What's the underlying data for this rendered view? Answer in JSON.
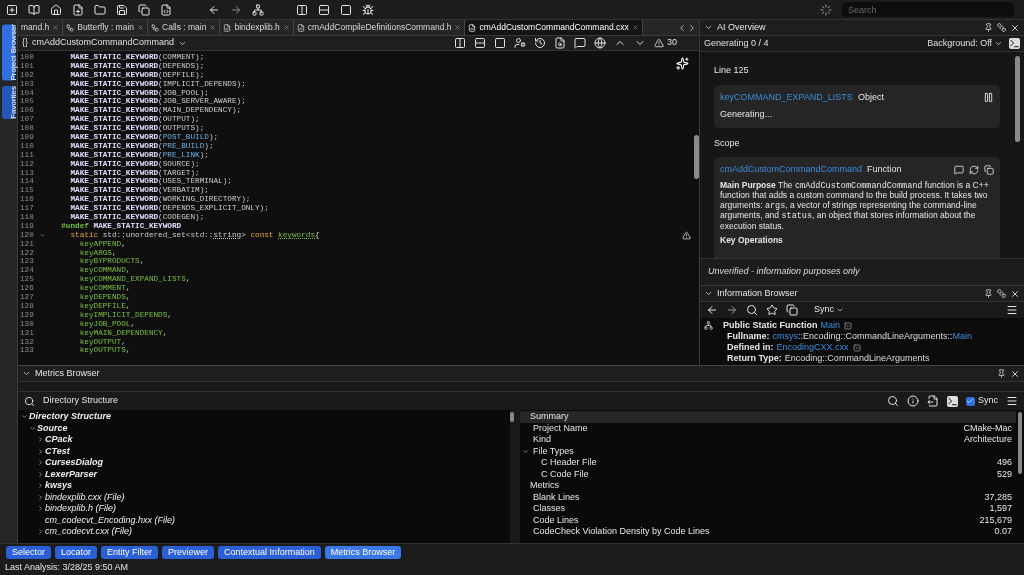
{
  "toolbar": {
    "search": {
      "placeholder": "Search"
    }
  },
  "side_tabs": [
    {
      "label": "Project Browser",
      "selected": true
    },
    {
      "label": "Favorites",
      "selected": false
    }
  ],
  "editor": {
    "tabs": [
      {
        "label": "mand.h",
        "kind": "plain",
        "selected": false
      },
      {
        "label": "Butterfly : main",
        "kind": "graph",
        "selected": false
      },
      {
        "label": "Calls : main",
        "kind": "graph",
        "selected": false
      },
      {
        "label": "bindexplib.h",
        "kind": "file",
        "selected": false
      },
      {
        "label": "cmAddCompileDefinitionsCommand.h",
        "kind": "file",
        "selected": false
      },
      {
        "label": "cmAddCustomCommandCommand.cxx",
        "kind": "file",
        "selected": true
      }
    ],
    "breadcrumb": {
      "symbol": "{}",
      "label": "cmAddCustomCommandCommand"
    },
    "warning_count": "30",
    "lines": [
      {
        "number": "100",
        "segments": [
          {
            "text": "    MAKE_STATIC_KEYWORD",
            "kind": "macro"
          },
          {
            "text": "(COMMENT);",
            "kind": "plain"
          }
        ]
      },
      {
        "number": "101",
        "segments": [
          {
            "text": "    MAKE_STATIC_KEYWORD",
            "kind": "macro"
          },
          {
            "text": "(DEPENDS);",
            "kind": "plain"
          }
        ]
      },
      {
        "number": "102",
        "segments": [
          {
            "text": "    MAKE_STATIC_KEYWORD",
            "kind": "macro"
          },
          {
            "text": "(DEPFILE);",
            "kind": "plain"
          }
        ]
      },
      {
        "number": "103",
        "segments": [
          {
            "text": "    MAKE_STATIC_KEYWORD",
            "kind": "macro"
          },
          {
            "text": "(IMPLICIT_DEPENDS);",
            "kind": "plain"
          }
        ]
      },
      {
        "number": "104",
        "segments": [
          {
            "text": "    MAKE_STATIC_KEYWORD",
            "kind": "macro"
          },
          {
            "text": "(JOB_POOL);",
            "kind": "plain"
          }
        ]
      },
      {
        "number": "105",
        "segments": [
          {
            "text": "    MAKE_STATIC_KEYWORD",
            "kind": "macro"
          },
          {
            "text": "(JOB_SERVER_AWARE);",
            "kind": "plain"
          }
        ]
      },
      {
        "number": "106",
        "segments": [
          {
            "text": "    MAKE_STATIC_KEYWORD",
            "kind": "macro"
          },
          {
            "text": "(MAIN_DEPENDENCY);",
            "kind": "plain"
          }
        ]
      },
      {
        "number": "107",
        "segments": [
          {
            "text": "    MAKE_STATIC_KEYWORD",
            "kind": "macro"
          },
          {
            "text": "(OUTPUT);",
            "kind": "plain"
          }
        ]
      },
      {
        "number": "108",
        "segments": [
          {
            "text": "    MAKE_STATIC_KEYWORD",
            "kind": "macro"
          },
          {
            "text": "(OUTPUTS);",
            "kind": "plain"
          }
        ]
      },
      {
        "number": "109",
        "segments": [
          {
            "text": "    MAKE_STATIC_KEYWORD",
            "kind": "macro"
          },
          {
            "text": "(",
            "kind": "plain"
          },
          {
            "text": "POST_BUILD",
            "kind": "constant"
          },
          {
            "text": ");",
            "kind": "plain"
          }
        ]
      },
      {
        "number": "110",
        "segments": [
          {
            "text": "    MAKE_STATIC_KEYWORD",
            "kind": "macro"
          },
          {
            "text": "(",
            "kind": "plain"
          },
          {
            "text": "PRE_BUILD",
            "kind": "constant"
          },
          {
            "text": ");",
            "kind": "plain"
          }
        ]
      },
      {
        "number": "111",
        "segments": [
          {
            "text": "    MAKE_STATIC_KEYWORD",
            "kind": "macro"
          },
          {
            "text": "(",
            "kind": "plain"
          },
          {
            "text": "PRE_LINK",
            "kind": "constant"
          },
          {
            "text": ");",
            "kind": "plain"
          }
        ]
      },
      {
        "number": "112",
        "segments": [
          {
            "text": "    MAKE_STATIC_KEYWORD",
            "kind": "macro"
          },
          {
            "text": "(SOURCE);",
            "kind": "plain"
          }
        ]
      },
      {
        "number": "113",
        "segments": [
          {
            "text": "    MAKE_STATIC_KEYWORD",
            "kind": "macro"
          },
          {
            "text": "(TARGET);",
            "kind": "plain"
          }
        ]
      },
      {
        "number": "114",
        "segments": [
          {
            "text": "    MAKE_STATIC_KEYWORD",
            "kind": "macro"
          },
          {
            "text": "(USES_TERMINAL);",
            "kind": "plain"
          }
        ]
      },
      {
        "number": "115",
        "segments": [
          {
            "text": "    MAKE_STATIC_KEYWORD",
            "kind": "macro"
          },
          {
            "text": "(VERBATIM);",
            "kind": "plain"
          }
        ]
      },
      {
        "number": "116",
        "segments": [
          {
            "text": "    MAKE_STATIC_KEYWORD",
            "kind": "macro"
          },
          {
            "text": "(WORKING_DIRECTORY);",
            "kind": "plain"
          }
        ]
      },
      {
        "number": "117",
        "segments": [
          {
            "text": "    MAKE_STATIC_KEYWORD",
            "kind": "macro"
          },
          {
            "text": "(DEPENDS_EXPLICIT_ONLY);",
            "kind": "plain"
          }
        ]
      },
      {
        "number": "118",
        "segments": [
          {
            "text": "    MAKE_STATIC_KEYWORD",
            "kind": "macro"
          },
          {
            "text": "(CODEGEN);",
            "kind": "plain"
          }
        ]
      },
      {
        "number": "119",
        "segments": [
          {
            "text": "  #undef",
            "kind": "preproc"
          },
          {
            "text": " MAKE_STATIC_KEYWORD",
            "kind": "macro"
          }
        ]
      },
      {
        "number": "120",
        "expanded": true,
        "warning": true,
        "segments": [
          {
            "text": "    static",
            "kind": "keyword"
          },
          {
            "text": " std::unordered_set<std::",
            "kind": "plain"
          },
          {
            "text": "string",
            "kind": "type"
          },
          {
            "text": "> ",
            "kind": "plain"
          },
          {
            "text": "const ",
            "kind": "keyword"
          },
          {
            "text": "keywords",
            "kind": "ident"
          },
          {
            "text": "{",
            "kind": "plain"
          }
        ]
      },
      {
        "number": "121",
        "segments": [
          {
            "text": "      keyAPPEND",
            "kind": "var"
          },
          {
            "text": ",",
            "kind": "plain"
          }
        ]
      },
      {
        "number": "122",
        "segments": [
          {
            "text": "      keyARGS",
            "kind": "var"
          },
          {
            "text": ",",
            "kind": "plain"
          }
        ]
      },
      {
        "number": "123",
        "segments": [
          {
            "text": "      keyBYPRODUCTS",
            "kind": "var"
          },
          {
            "text": ",",
            "kind": "plain"
          }
        ]
      },
      {
        "number": "124",
        "segments": [
          {
            "text": "      keyCOMMAND",
            "kind": "var"
          },
          {
            "text": ",",
            "kind": "plain"
          }
        ]
      },
      {
        "number": "125",
        "segments": [
          {
            "text": "      keyCOMMAND_EXPAND_LISTS",
            "kind": "var"
          },
          {
            "text": ",",
            "kind": "plain"
          }
        ]
      },
      {
        "number": "126",
        "segments": [
          {
            "text": "      keyCOMMENT",
            "kind": "var"
          },
          {
            "text": ",",
            "kind": "plain"
          }
        ]
      },
      {
        "number": "127",
        "segments": [
          {
            "text": "      keyDEPENDS",
            "kind": "var"
          },
          {
            "text": ",",
            "kind": "plain"
          }
        ]
      },
      {
        "number": "128",
        "segments": [
          {
            "text": "      keyDEPFILE",
            "kind": "var"
          },
          {
            "text": ",",
            "kind": "plain"
          }
        ]
      },
      {
        "number": "129",
        "segments": [
          {
            "text": "      keyIMPLICIT_DEPENDS",
            "kind": "var"
          },
          {
            "text": ",",
            "kind": "plain"
          }
        ]
      },
      {
        "number": "130",
        "segments": [
          {
            "text": "      keyJOB_POOL",
            "kind": "var"
          },
          {
            "text": ",",
            "kind": "plain"
          }
        ]
      },
      {
        "number": "131",
        "segments": [
          {
            "text": "      keyMAIN_DEPENDENCY",
            "kind": "var"
          },
          {
            "text": ",",
            "kind": "plain"
          }
        ]
      },
      {
        "number": "132",
        "segments": [
          {
            "text": "      keyOUTPUT",
            "kind": "var"
          },
          {
            "text": ",",
            "kind": "plain"
          }
        ]
      },
      {
        "number": "133",
        "segments": [
          {
            "text": "      keyOUTPUTS",
            "kind": "var"
          },
          {
            "text": ",",
            "kind": "plain"
          }
        ]
      }
    ]
  },
  "ai_overview": {
    "title": "AI Overview",
    "expanded": true,
    "progress": "Generating 0 / 4",
    "background": "Background: Off",
    "sections": [
      {
        "title": "Line 125",
        "card": {
          "kind": "pending",
          "name": "keyCOMMAND_EXPAND_LISTS",
          "type": "Object",
          "status": "Generating..."
        }
      },
      {
        "title": "Scope",
        "card": {
          "kind": "done",
          "name": "cmAddCustomCommandCommand",
          "type": "Function",
          "paragraph": [
            {
              "text": "Main Purpose",
              "kind": "bold"
            },
            {
              "text": " The ",
              "kind": "plain"
            },
            {
              "text": "cmAddCustomCommandCommand",
              "kind": "code"
            },
            {
              "text": " function is a C++ function that adds a custom command to the build process. It takes two arguments: ",
              "kind": "plain"
            },
            {
              "text": "args",
              "kind": "code"
            },
            {
              "text": ", a vector of strings representing the command-line arguments, and ",
              "kind": "plain"
            },
            {
              "text": "status",
              "kind": "code"
            },
            {
              "text": ", an object that stores information about the execution status.",
              "kind": "plain"
            }
          ],
          "heading": "Key Operations"
        }
      }
    ],
    "footer": "Unverified - information purposes only"
  },
  "info_browser": {
    "title": "Information Browser",
    "expanded": true,
    "sync": "Sync",
    "lines": [
      {
        "kind": "heading",
        "menu": true,
        "segments": [
          {
            "text": "Public Static Function",
            "kind": "label"
          },
          {
            "text": "Main",
            "kind": "link"
          }
        ]
      },
      {
        "kind": "field",
        "menu": false,
        "segments": [
          {
            "text": "Fullname:",
            "kind": "label"
          },
          {
            "text": "cmsys",
            "kind": "link"
          },
          {
            "text": "::Encoding::CommandLineArguments::",
            "kind": "plain"
          },
          {
            "text": "Main",
            "kind": "link"
          }
        ]
      },
      {
        "kind": "field",
        "menu": true,
        "segments": [
          {
            "text": "Defined in:",
            "kind": "label"
          },
          {
            "text": "EncodingCXX.cxx",
            "kind": "link"
          }
        ]
      },
      {
        "kind": "field",
        "menu": false,
        "segments": [
          {
            "text": "Return Type:",
            "kind": "label"
          },
          {
            "text": "Encoding::CommandLineArguments",
            "kind": "plain"
          }
        ]
      }
    ]
  },
  "metrics": {
    "title": "Metrics Browser",
    "expanded": true,
    "search": {
      "value": "Directory Structure"
    },
    "sync": {
      "label": "Sync",
      "checked": true
    },
    "tree": [
      {
        "label": "Directory Structure",
        "kind": "folder",
        "expanded": true,
        "children": [
          {
            "label": "Source",
            "kind": "folder",
            "expanded": true,
            "children": [
              {
                "label": "CPack",
                "kind": "folder",
                "expanded": false
              },
              {
                "label": "CTest",
                "kind": "folder",
                "expanded": false
              },
              {
                "label": "CursesDialog",
                "kind": "folder",
                "expanded": false
              },
              {
                "label": "LexerParser",
                "kind": "folder",
                "expanded": false
              },
              {
                "label": "kwsys",
                "kind": "folder",
                "expanded": false
              },
              {
                "label": "bindexplib.cxx (File)",
                "kind": "file",
                "expanded": false
              },
              {
                "label": "bindexplib.h (File)",
                "kind": "file",
                "expanded": false
              },
              {
                "label": "cm_codecvt_Encoding.hxx (File)",
                "kind": "file"
              },
              {
                "label": "cm_codecvt.cxx (File)",
                "kind": "file",
                "expanded": false
              }
            ]
          }
        ]
      }
    ],
    "summary": [
      {
        "label": "Summary",
        "selected": true,
        "children": [
          {
            "label": "Project Name",
            "value": "CMake-Mac"
          },
          {
            "label": "Kind",
            "value": "Architecture"
          },
          {
            "label": "File Types",
            "expanded": true,
            "children": [
              {
                "label": "C Header File",
                "value": "496"
              },
              {
                "label": "C Code File",
                "value": "529"
              }
            ]
          }
        ]
      },
      {
        "label": "Metrics",
        "selected": false,
        "children": [
          {
            "label": "Blank Lines",
            "value": "37,285"
          },
          {
            "label": "Classes",
            "value": "1,597"
          },
          {
            "label": "Code Lines",
            "value": "215,679"
          },
          {
            "label": "CodeCheck Violation Density by Code Lines",
            "value": "0.07"
          }
        ]
      }
    ]
  },
  "bottom_tabs": [
    {
      "label": "Selector",
      "selected": false
    },
    {
      "label": "Locator",
      "selected": false
    },
    {
      "label": "Entity Filter",
      "selected": false
    },
    {
      "label": "Previewer",
      "selected": false
    },
    {
      "label": "Contextual Information",
      "selected": false
    },
    {
      "label": "Metrics Browser",
      "selected": true
    }
  ],
  "status_bar": "Last Analysis: 3/28/25 9:50 AM"
}
